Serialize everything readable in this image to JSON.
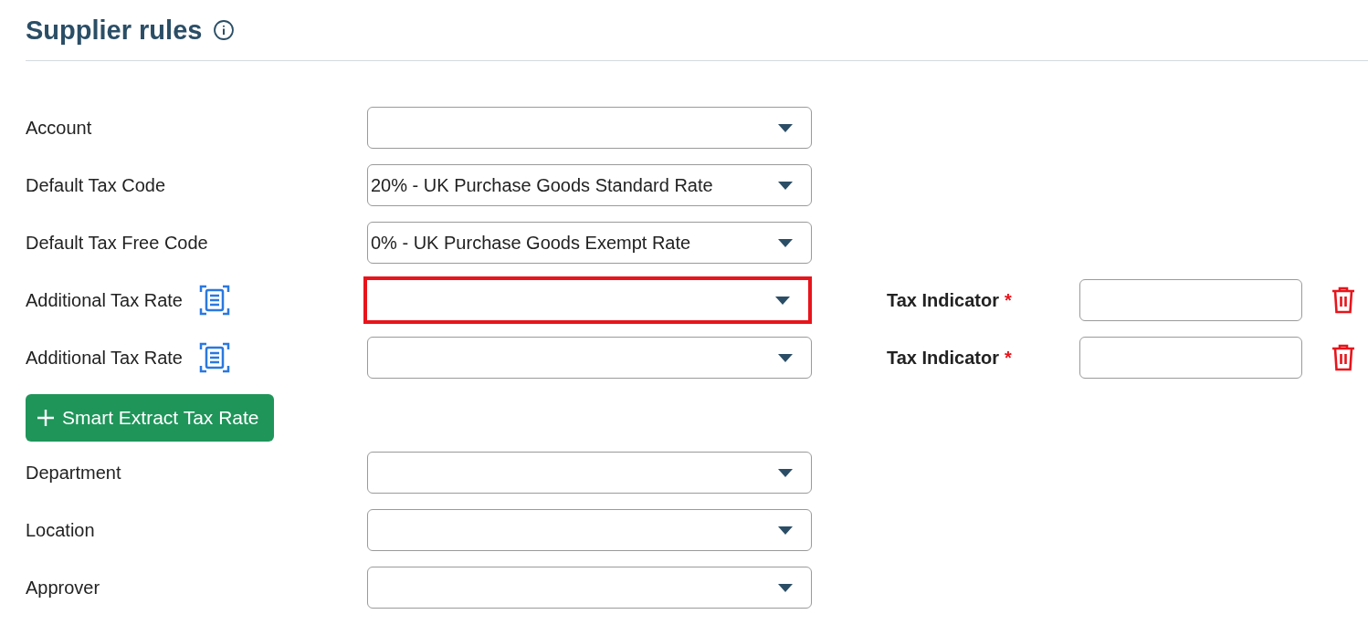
{
  "header": {
    "title": "Supplier rules"
  },
  "rows": [
    {
      "kind": "select",
      "label": "Account"
    },
    {
      "kind": "select",
      "label": "Default Tax Code",
      "value": "20% - UK Purchase Goods Standard Rate"
    },
    {
      "kind": "select",
      "label": "Default Tax Free Code",
      "value": "0% - UK Purchase Goods Exempt Rate"
    },
    {
      "kind": "tax_rate",
      "label": "Additional Tax Rate",
      "highlighted": true,
      "indicator_label": "Tax Indicator",
      "required_mark": "*"
    },
    {
      "kind": "tax_rate",
      "label": "Additional Tax Rate",
      "highlighted": false,
      "indicator_label": "Tax Indicator",
      "required_mark": "*"
    },
    {
      "kind": "button",
      "label": "Smart Extract Tax Rate"
    },
    {
      "kind": "select",
      "label": "Department"
    },
    {
      "kind": "select",
      "label": "Location"
    },
    {
      "kind": "select",
      "label": "Approver"
    }
  ]
}
